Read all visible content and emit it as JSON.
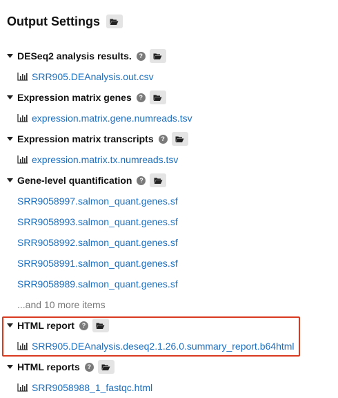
{
  "header": {
    "title": "Output Settings",
    "folder_icon": "folder-open-icon"
  },
  "sections": [
    {
      "title": "DESeq2 analysis results.",
      "help": "?",
      "files": [
        {
          "name": "SRR905.DEAnalysis.out.csv",
          "icon": "bar-chart-icon"
        }
      ]
    },
    {
      "title": "Expression matrix genes",
      "help": "?",
      "files": [
        {
          "name": "expression.matrix.gene.numreads.tsv",
          "icon": "bar-chart-icon"
        }
      ]
    },
    {
      "title": "Expression matrix transcripts",
      "help": "?",
      "files": [
        {
          "name": "expression.matrix.tx.numreads.tsv",
          "icon": "bar-chart-icon"
        }
      ]
    },
    {
      "title": "Gene-level quantification",
      "help": "?",
      "files": [
        {
          "name": "SRR9058997.salmon_quant.genes.sf"
        },
        {
          "name": "SRR9058993.salmon_quant.genes.sf"
        },
        {
          "name": "SRR9058992.salmon_quant.genes.sf"
        },
        {
          "name": "SRR9058991.salmon_quant.genes.sf"
        },
        {
          "name": "SRR9058989.salmon_quant.genes.sf"
        }
      ],
      "more": "...and 10 more items"
    },
    {
      "title": "HTML report",
      "help": "?",
      "files": [
        {
          "name": "SRR905.DEAnalysis.deseq2.1.26.0.summary_report.b64html",
          "icon": "bar-chart-icon"
        }
      ]
    },
    {
      "title": "HTML reports",
      "help": "?",
      "files": [
        {
          "name": "SRR9058988_1_fastqc.html",
          "icon": "bar-chart-icon"
        }
      ]
    }
  ],
  "colors": {
    "link": "#1a6fc0",
    "highlight": "#d93a1f",
    "button_bg": "#e4e4e4"
  }
}
